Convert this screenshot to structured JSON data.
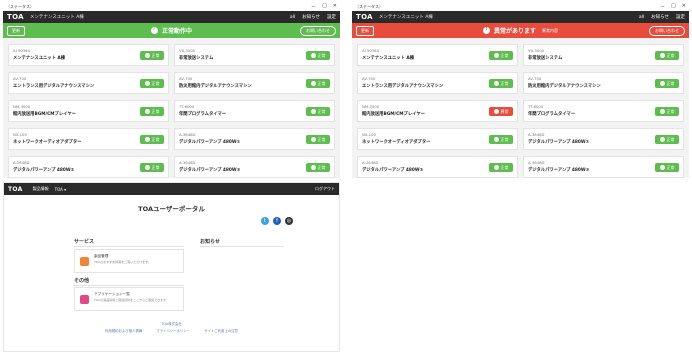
{
  "window": {
    "title": "（ステータス）",
    "controls": [
      "－",
      "□",
      "✕"
    ]
  },
  "app": {
    "logo": "TOA",
    "name": "メンテナンスユニット A棟",
    "signal": "all",
    "menu1": "お知らせ",
    "menu2": "設定"
  },
  "screen_ok": {
    "status_text": "正常動作中",
    "btn_left": "更新",
    "btn_right": "お問い合わせ"
  },
  "screen_err": {
    "status_text": "異常があります",
    "status_sub": "異常内容",
    "btn_left": "更新",
    "btn_right": "お問い合わせ"
  },
  "devices_ok": [
    {
      "model": "AI 5036U",
      "name": "メンテナンスユニット A棟",
      "status": "正常"
    },
    {
      "model": "VX-3000",
      "name": "非常放送システム",
      "status": "正常"
    },
    {
      "model": "AV-700",
      "name": "エントランス用デジタルアナウンスマシン",
      "status": "正常"
    },
    {
      "model": "AV-700",
      "name": "防災用館内デジタルアナウンスマシン",
      "status": "正常"
    },
    {
      "model": "NM-3000",
      "name": "館内放送用BGM/CMプレイヤー",
      "status": "正常"
    },
    {
      "model": "TT-6000",
      "name": "年間プログラムタイマー",
      "status": "正常"
    },
    {
      "model": "NX-100",
      "name": "ネットワークオーディオアダプター",
      "status": "正常"
    },
    {
      "model": "A-3648D",
      "name": "デジタルパワーアンプ 480W①",
      "status": "正常"
    },
    {
      "model": "A-2648D",
      "name": "デジタルパワーアンプ 480W②",
      "status": "正常"
    },
    {
      "model": "A-3648D",
      "name": "デジタルパワーアンプ 480W③",
      "status": "正常"
    }
  ],
  "devices_err": [
    {
      "model": "AI 5036U",
      "name": "メンテナンスユニット A棟",
      "status": "正常",
      "state": "ok"
    },
    {
      "model": "VX-3000",
      "name": "非常放送システム",
      "status": "正常",
      "state": "ok"
    },
    {
      "model": "AV-700",
      "name": "エントランス用デジタルアナウンスマシン",
      "status": "正常",
      "state": "ok"
    },
    {
      "model": "AV-700",
      "name": "防災用館内デジタルアナウンスマシン",
      "status": "正常",
      "state": "ok"
    },
    {
      "model": "NM-3000",
      "name": "館内放送用BGM/CMプレイヤー",
      "status": "異常",
      "state": "err"
    },
    {
      "model": "TT-6000",
      "name": "年間プログラムタイマー",
      "status": "正常",
      "state": "ok"
    },
    {
      "model": "NX-100",
      "name": "ネットワークオーディオアダプター",
      "status": "正常",
      "state": "ok"
    },
    {
      "model": "A-3648D",
      "name": "デジタルパワーアンプ 480W①",
      "status": "正常",
      "state": "ok"
    },
    {
      "model": "A-2648D",
      "name": "デジタルパワーアンプ 480W②",
      "status": "正常",
      "state": "ok"
    },
    {
      "model": "A-3648D",
      "name": "デジタルパワーアンプ 480W③",
      "status": "正常",
      "state": "ok"
    }
  ],
  "portal": {
    "nav": [
      "TOA",
      "製品情報",
      "TOA ▾"
    ],
    "right": "ログアウト",
    "title": "TOAユーザーポータル",
    "services_heading": "サービス",
    "news_heading": "お知らせ",
    "other_heading": "その他",
    "service1_title": "製品管理",
    "service1_desc": "TOAのおすすめ情報をご覧いただけます。",
    "service2_title": "アプリケーション一覧",
    "service2_desc": "TOAの製品情報と関連資料をここからご確認できます",
    "footer_company": "TOA株式会社",
    "footer_links": [
      "利用規約および個人情報",
      "プライバシーポリシー",
      "サイトご利用上の注意"
    ]
  },
  "colors": {
    "ok": "#5dbd4e",
    "err": "#e74c3c",
    "appbar": "#2a2a2a"
  }
}
